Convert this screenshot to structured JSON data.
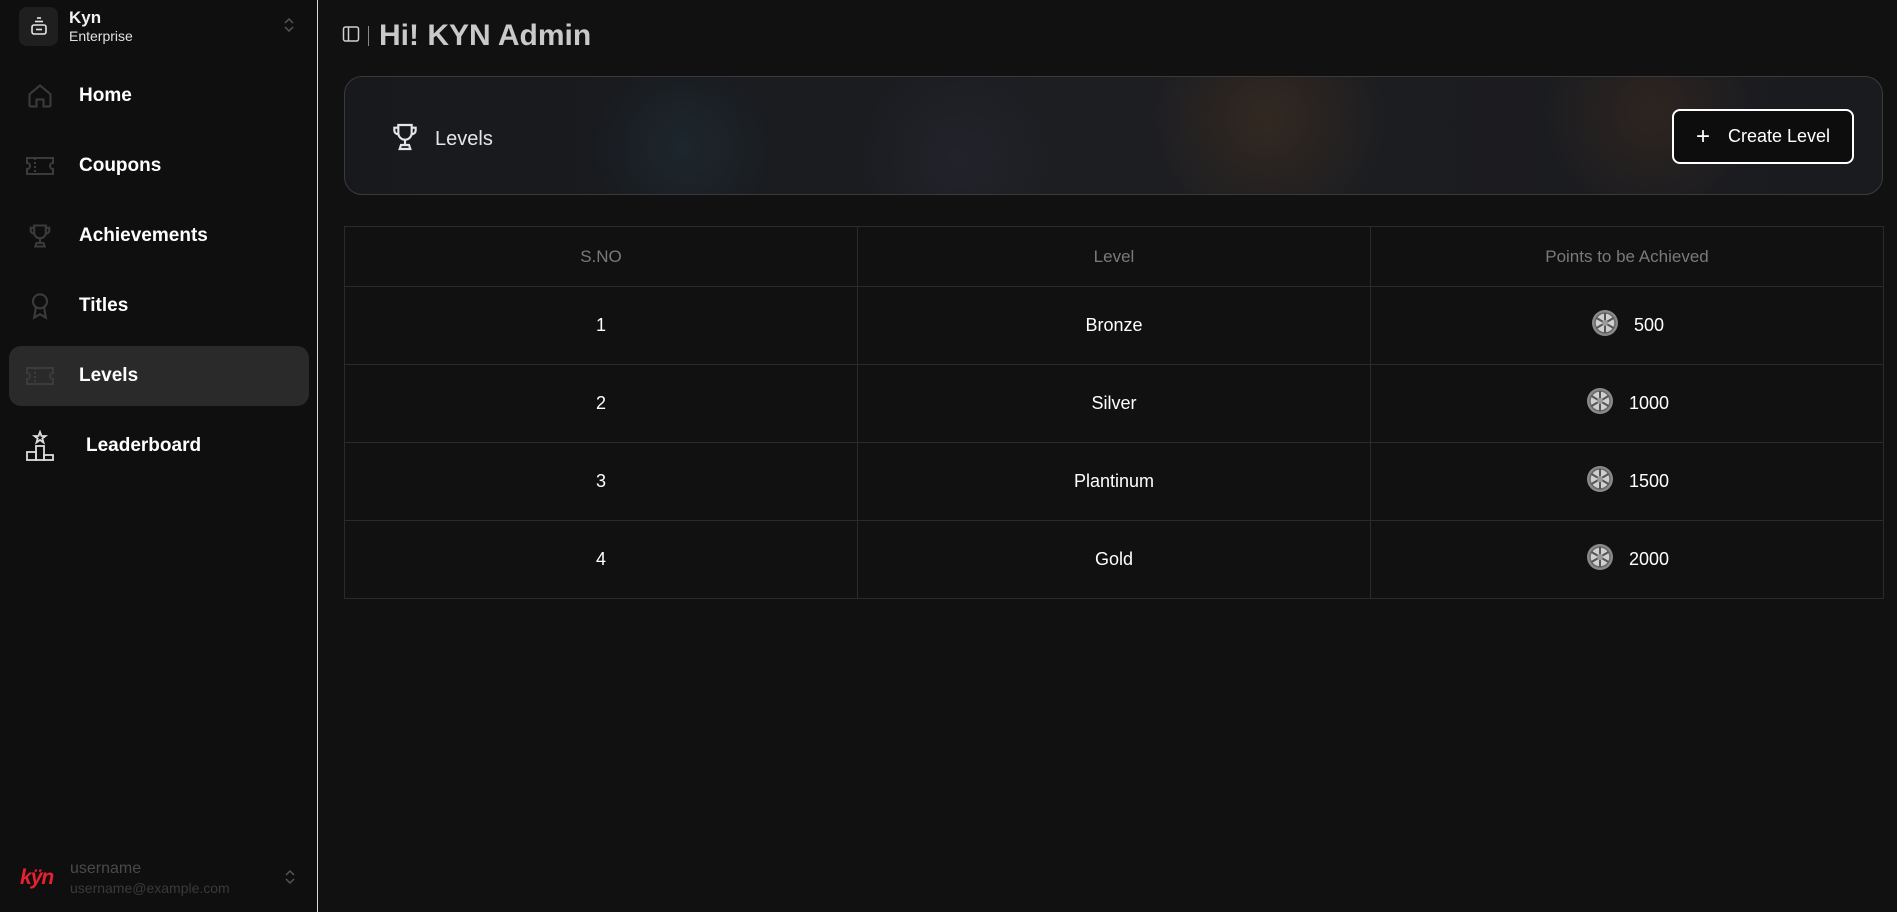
{
  "org": {
    "name": "Kyn",
    "plan": "Enterprise"
  },
  "nav": [
    {
      "label": "Home",
      "icon": "home-icon"
    },
    {
      "label": "Coupons",
      "icon": "ticket-icon"
    },
    {
      "label": "Achievements",
      "icon": "trophy-icon"
    },
    {
      "label": "Titles",
      "icon": "award-icon"
    },
    {
      "label": "Levels",
      "icon": "ticket-icon",
      "active": true
    },
    {
      "label": "Leaderboard",
      "icon": "podium-icon"
    }
  ],
  "user": {
    "logo": "kÿn",
    "name": "username",
    "email": "username@example.com"
  },
  "header": {
    "title": "Hi! KYN Admin"
  },
  "banner": {
    "label": "Levels",
    "button_label": "Create Level",
    "button_icon": "plus"
  },
  "table": {
    "headers": [
      "S.NO",
      "Level",
      "Points to be Achieved"
    ],
    "rows": [
      {
        "sno": "1",
        "level": "Bronze",
        "points": "500"
      },
      {
        "sno": "2",
        "level": "Silver",
        "points": "1000"
      },
      {
        "sno": "3",
        "level": "Plantinum",
        "points": "1500"
      },
      {
        "sno": "4",
        "level": "Gold",
        "points": "2000"
      }
    ]
  },
  "colors": {
    "background": "#111111",
    "brand": "#e8212f",
    "active_nav": "#2a2a2a"
  }
}
